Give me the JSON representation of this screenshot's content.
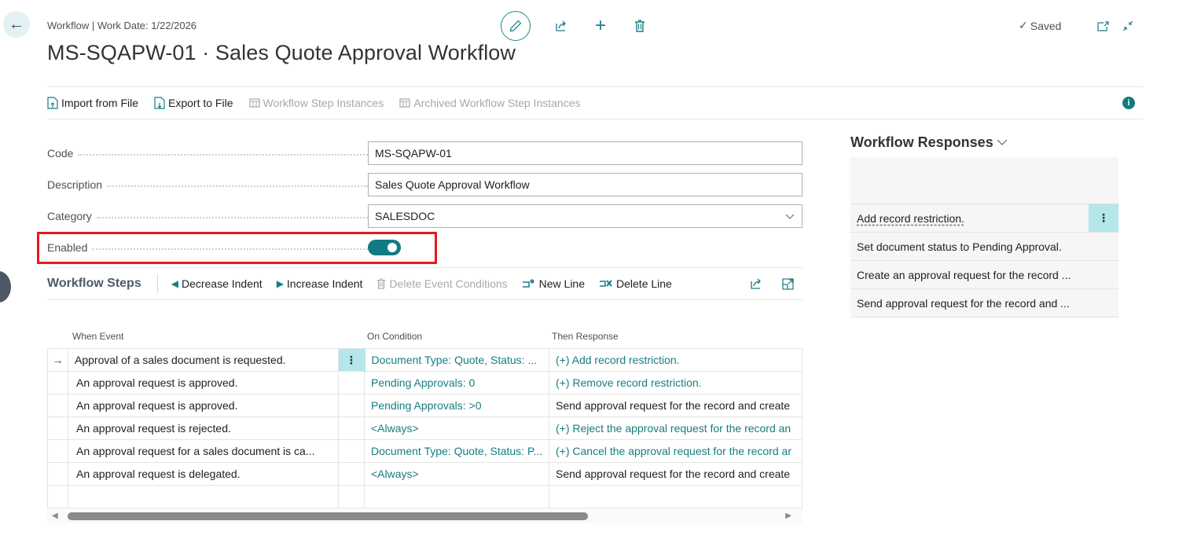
{
  "header": {
    "breadcrumb": "Workflow | Work Date: 1/22/2026",
    "title": "MS-SQAPW-01 · Sales Quote Approval Workflow",
    "status": "Saved",
    "icons": [
      "back-arrow-icon",
      "edit-pencil-icon",
      "share-icon",
      "add-icon",
      "delete-icon",
      "checkmark-icon",
      "open-new-window-icon",
      "collapse-icon"
    ]
  },
  "actions": [
    {
      "label": "Import from File",
      "icon": "import-file-icon",
      "enabled": true
    },
    {
      "label": "Export to File",
      "icon": "export-file-icon",
      "enabled": true
    },
    {
      "label": "Workflow Step Instances",
      "icon": "table-icon",
      "enabled": false
    },
    {
      "label": "Archived Workflow Step Instances",
      "icon": "table-icon",
      "enabled": false
    }
  ],
  "form": {
    "code": {
      "label": "Code",
      "value": "MS-SQAPW-01"
    },
    "description": {
      "label": "Description",
      "value": "Sales Quote Approval Workflow"
    },
    "category": {
      "label": "Category",
      "value": "SALESDOC"
    },
    "enabled": {
      "label": "Enabled",
      "value": true
    }
  },
  "steps": {
    "title": "Workflow Steps",
    "actions": [
      {
        "label": "Decrease Indent",
        "enabled": true
      },
      {
        "label": "Increase Indent",
        "enabled": true
      },
      {
        "label": "Delete Event Conditions",
        "enabled": false
      },
      {
        "label": "New Line",
        "enabled": true
      },
      {
        "label": "Delete Line",
        "enabled": true
      }
    ],
    "columns": [
      "When Event",
      "On Condition",
      "Then Response"
    ],
    "rows": [
      {
        "event": "Approval of a sales document is requested.",
        "condition": "Document Type: Quote, Status: ...",
        "response": "(+) Add record restriction.",
        "response_link": true,
        "current": true
      },
      {
        "event": "An approval request is approved.",
        "condition": "Pending Approvals: 0",
        "response": "(+) Remove record restriction.",
        "response_link": true
      },
      {
        "event": "An approval request is approved.",
        "condition": "Pending Approvals: >0",
        "response": "Send approval request for the record and create",
        "response_link": false
      },
      {
        "event": "An approval request is rejected.",
        "condition": "<Always>",
        "response": "(+) Reject the approval request for the record an",
        "response_link": true
      },
      {
        "event": "An approval request for a sales document is ca...",
        "condition": "Document Type: Quote, Status: P...",
        "response": "(+) Cancel the approval request for the record ar",
        "response_link": true
      },
      {
        "event": "An approval request is delegated.",
        "condition": "<Always>",
        "response": "Send approval request for the record and create",
        "response_link": false
      }
    ]
  },
  "responses": {
    "title": "Workflow Responses",
    "items": [
      "Add record restriction.",
      "Set document status to Pending Approval.",
      "Create an approval request for the record ...",
      "Send approval request for the record and ..."
    ]
  },
  "colors": {
    "accent": "#127a80",
    "highlight": "#e81a1a",
    "selection": "#b4e6ea"
  }
}
